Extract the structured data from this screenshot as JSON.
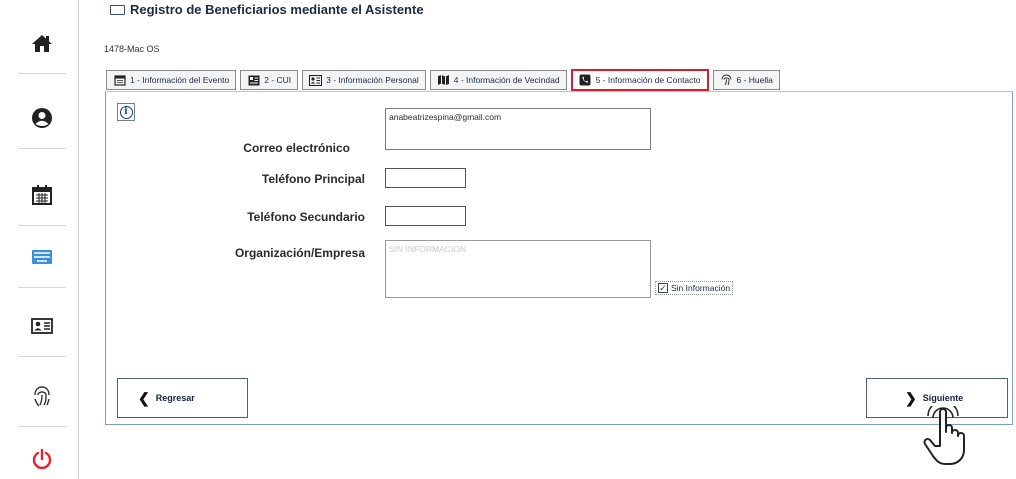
{
  "header": {
    "title": "Registro de Beneficiarios mediante el Asistente",
    "subtitle": "1478-Mac OS"
  },
  "sidebar": {
    "items": [
      {
        "icon": "home-icon"
      },
      {
        "icon": "user-circle-icon"
      },
      {
        "icon": "calendar-icon"
      },
      {
        "icon": "keyboard-icon"
      },
      {
        "icon": "id-card-icon"
      },
      {
        "icon": "fingerprint-icon"
      },
      {
        "icon": "power-icon"
      }
    ]
  },
  "tabs": [
    {
      "label": "1 - Información del Evento",
      "icon": "calendar-icon",
      "active": false
    },
    {
      "label": "2 - CUI",
      "icon": "id-badge-icon",
      "active": false
    },
    {
      "label": "3 - Información Personal",
      "icon": "id-card-icon",
      "active": false
    },
    {
      "label": "4 - Información de Vecindad",
      "icon": "map-icon",
      "active": false
    },
    {
      "label": "5 - Información de Contacto",
      "icon": "phone-icon",
      "active": true
    },
    {
      "label": "6 - Huella",
      "icon": "fingerprint-icon",
      "active": false
    }
  ],
  "form": {
    "email_label": "Correo electrónico",
    "email_value": "anabeatrizespina@gmail.com",
    "phone_primary_label": "Teléfono Principal",
    "phone_primary_value": "",
    "phone_secondary_label": "Teléfono Secundario",
    "phone_secondary_value": "",
    "org_label": "Organización/Empresa",
    "org_value": "SIN INFORMACION",
    "no_info_label": "Sin Información",
    "no_info_checked": true
  },
  "buttons": {
    "back_label": "Regresar",
    "next_label": "Siguiente"
  },
  "colors": {
    "active_tab_border": "#d6202f",
    "panel_border": "#7aa0c9",
    "power_icon": "#e8242a",
    "keyboard_icon": "#3a8fd6"
  }
}
